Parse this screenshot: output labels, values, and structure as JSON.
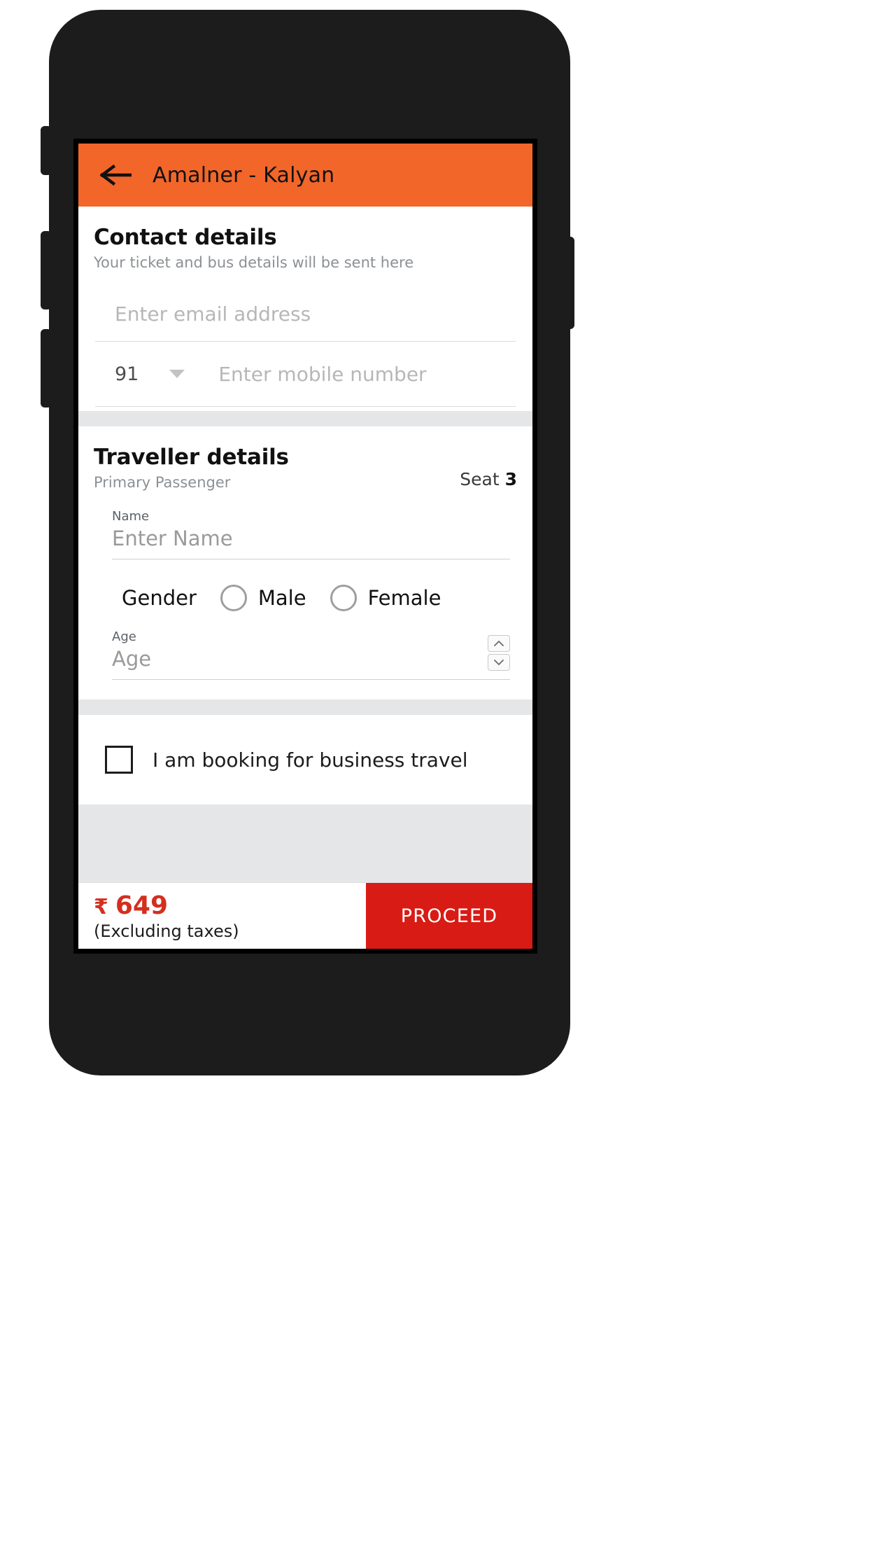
{
  "app_bar": {
    "back_icon": "back-arrow-icon",
    "title": "Amalner - Kalyan"
  },
  "contact": {
    "title": "Contact details",
    "subtitle": "Your ticket and bus details will be sent here",
    "email_placeholder": "Enter email address",
    "email_value": "",
    "country_code": "91",
    "country_code_caret": "chevron-down-icon",
    "mobile_placeholder": "Enter mobile number",
    "mobile_value": ""
  },
  "traveller": {
    "title": "Traveller details",
    "subtitle": "Primary Passenger",
    "seat_prefix": "Seat ",
    "seat_number": "3",
    "name_label": "Name",
    "name_placeholder": "Enter Name",
    "name_value": "",
    "gender_label": "Gender",
    "gender_options": [
      {
        "label": "Male",
        "selected": false
      },
      {
        "label": "Female",
        "selected": false
      }
    ],
    "age_label": "Age",
    "age_placeholder": "Age",
    "age_value": "",
    "stepper_up_icon": "chevron-up-icon",
    "stepper_down_icon": "chevron-down-icon"
  },
  "business": {
    "checkbox_checked": false,
    "label": "I am booking for business travel"
  },
  "bottom_bar": {
    "currency_symbol": "₹",
    "price": "649",
    "tax_note": "(Excluding taxes)",
    "proceed_label": "PROCEED"
  },
  "colors": {
    "header_orange": "#f2662a",
    "proceed_red": "#d81b15",
    "price_red": "#d32f1f",
    "section_gap": "#e4e6e8"
  }
}
